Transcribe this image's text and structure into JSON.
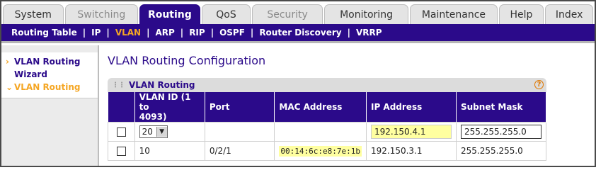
{
  "top_tabs": [
    {
      "label": "System",
      "state": "normal"
    },
    {
      "label": "Switching",
      "state": "dim"
    },
    {
      "label": "Routing",
      "state": "active"
    },
    {
      "label": "QoS",
      "state": "normal"
    },
    {
      "label": "Security",
      "state": "dim"
    },
    {
      "label": "Monitoring",
      "state": "normal"
    },
    {
      "label": "Maintenance",
      "state": "normal"
    },
    {
      "label": "Help",
      "state": "normal"
    },
    {
      "label": "Index",
      "state": "normal"
    }
  ],
  "sub_nav": [
    "Routing Table",
    "IP",
    "VLAN",
    "ARP",
    "RIP",
    "OSPF",
    "Router Discovery",
    "VRRP"
  ],
  "sub_nav_active": "VLAN",
  "sidebar": {
    "item1_line1": "VLAN Routing",
    "item1_line2": "Wizard",
    "item2": "VLAN Routing"
  },
  "page_title": "VLAN Routing Configuration",
  "panel_title": "VLAN Routing",
  "help_icon": "?",
  "table": {
    "headers": {
      "vlan_line1": "VLAN ID (1 to",
      "vlan_line2": "4093)",
      "port": "Port",
      "mac": "MAC Address",
      "ip": "IP Address",
      "mask": "Subnet Mask"
    },
    "edit_row": {
      "vlan_select": "20",
      "ip": "192.150.4.1",
      "mask": "255.255.255.0"
    },
    "rows": [
      {
        "vlan": "10",
        "port": "0/2/1",
        "mac": "00:14:6c:e8:7e:1b",
        "ip": "192.150.3.1",
        "mask": "255.255.255.0"
      }
    ]
  }
}
